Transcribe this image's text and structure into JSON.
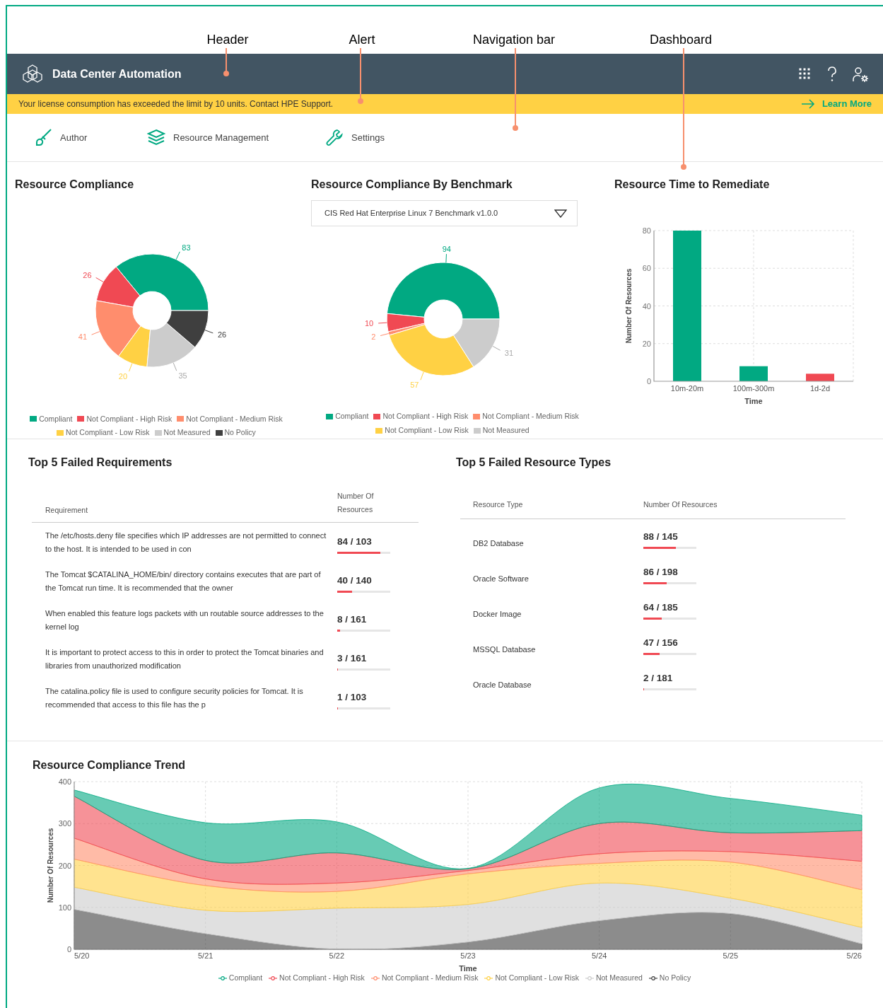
{
  "annotations": [
    {
      "label": "Header"
    },
    {
      "label": "Alert"
    },
    {
      "label": "Navigation bar"
    },
    {
      "label": "Dashboard"
    }
  ],
  "header": {
    "title": "Data Center Automation"
  },
  "alert": {
    "message": "Your license consumption has exceeded the limit by 10 units. Contact HPE Support.",
    "link": "Learn More"
  },
  "nav": {
    "items": [
      {
        "label": "Author"
      },
      {
        "label": "Resource Management"
      },
      {
        "label": "Settings"
      }
    ]
  },
  "resource_compliance": {
    "title": "Resource Compliance",
    "chart_data": {
      "type": "donut",
      "data_labels": true,
      "categories": [
        "Compliant",
        "Not Compliant - High Risk",
        "Not Compliant - Medium Risk",
        "Not Compliant - Low Risk",
        "Not Measured",
        "No Policy"
      ],
      "values": [
        83,
        26,
        41,
        20,
        35,
        26
      ]
    },
    "legend": [
      {
        "color": "#01a982"
      },
      {
        "color": "#f04953"
      },
      {
        "color": "#ff8d6d"
      },
      {
        "color": "#ffd144"
      },
      {
        "color": "#cccccc"
      },
      {
        "color": "#3f3f3f"
      }
    ]
  },
  "compliance_by_benchmark": {
    "title": "Resource Compliance By Benchmark",
    "dropdown": {
      "value": "CIS Red Hat Enterprise Linux 7 Benchmark v1.0.0"
    },
    "chart_data": {
      "type": "donut",
      "data_labels": true,
      "categories": [
        "Compliant",
        "Not Compliant - High Risk",
        "Not Compliant - Medium Risk",
        "Not Compliant - Low Risk",
        "Not Measured"
      ],
      "values": [
        94,
        10,
        2,
        57,
        31
      ]
    },
    "legend": [
      {
        "color": "#01a982"
      },
      {
        "color": "#f04953"
      },
      {
        "color": "#ff8d6d"
      },
      {
        "color": "#ffd144"
      },
      {
        "color": "#cccccc"
      }
    ]
  },
  "time_to_remediate": {
    "title": "Resource Time to Remediate",
    "chart_data": {
      "type": "bar",
      "stacked": true,
      "xlabel": "Time",
      "ylabel": "Number Of Resources",
      "categories": [
        "10m-20m",
        "100m-300m",
        "1d-2d"
      ],
      "grid": true,
      "ylim": [
        0,
        80
      ],
      "yticks": [
        0,
        20,
        40,
        60,
        80
      ],
      "series": [
        {
          "color": "#01a982",
          "values": [
            80,
            8,
            null
          ]
        },
        {
          "color": "#f04953",
          "values": [
            null,
            null,
            4
          ]
        }
      ]
    }
  },
  "failed_requirements": {
    "title": "Top 5 Failed Requirements",
    "columns": [
      "Requirement",
      "Number Of Resources"
    ],
    "rows": [
      {
        "requirement": "The /etc/hosts.deny file specifies which IP addresses are not permitted to connect to the host. It is intended to be used in con",
        "count": "84 / 103",
        "level": 0.816
      },
      {
        "requirement": "The Tomcat $CATALINA_HOME/bin/ directory contains executes that are part of the Tomcat run time. It is recommended that the owner",
        "count": "40 / 140",
        "level": 0.286
      },
      {
        "requirement": "When enabled this feature logs packets with un routable source addresses to the kernel log",
        "count": "8 / 161",
        "level": 0.05
      },
      {
        "requirement": "It is important to protect access to this in order to protect the Tomcat binaries and libraries from unauthorized modification",
        "count": "3 / 161",
        "level": 0.019
      },
      {
        "requirement": "The catalina.policy file is used to configure security policies for Tomcat. It is recommended that access to this file has the p",
        "count": "1 / 103",
        "level": 0.01
      }
    ]
  },
  "failed_resource_types": {
    "title": "Top 5 Failed Resource Types",
    "columns": [
      "Resource Type",
      "Number Of Resources"
    ],
    "rows": [
      {
        "type": "DB2 Database",
        "count": "88 / 145",
        "level": 0.607
      },
      {
        "type": "Oracle Software",
        "count": "86 / 198",
        "level": 0.434
      },
      {
        "type": "Docker Image",
        "count": "64 / 185",
        "level": 0.346
      },
      {
        "type": "MSSQL Database",
        "count": "47 / 156",
        "level": 0.301
      },
      {
        "type": "Oracle Database",
        "count": "2 / 181",
        "level": 0.011
      }
    ]
  },
  "compliance_trend": {
    "title": "Resource Compliance Trend",
    "chart_data": {
      "type": "area",
      "stacked": true,
      "xlabel": "Time",
      "ylabel": "Number Of Resources",
      "categories": [
        "5/20",
        "5/21",
        "5/22",
        "5/23",
        "5/24",
        "5/25",
        "5/26"
      ],
      "grid": true,
      "ylim": [
        0,
        400
      ],
      "yticks": [
        0,
        100,
        200,
        300,
        400
      ],
      "series": [
        {
          "name": "Compliant",
          "color": "#01a982",
          "values": [
            15,
            90,
            74,
            1,
            85,
            82,
            37
          ]
        },
        {
          "name": "Not Compliant - High Risk",
          "color": "#f04953",
          "values": [
            100,
            44,
            72,
            4,
            72,
            45,
            73
          ]
        },
        {
          "name": "Not Compliant - Medium Risk",
          "color": "#ff8d6d",
          "values": [
            50,
            16,
            20,
            8,
            23,
            25,
            68
          ]
        },
        {
          "name": "Not Compliant - Low Risk",
          "color": "#ffd144",
          "values": [
            67,
            59,
            40,
            73,
            47,
            86,
            90
          ]
        },
        {
          "name": "Not Measured",
          "color": "#cccccc",
          "values": [
            53,
            56,
            98,
            90,
            90,
            37,
            39
          ]
        },
        {
          "name": "No Policy",
          "color": "#3f3f3f",
          "values": [
            95,
            37,
            0,
            17,
            68,
            85,
            13
          ]
        }
      ]
    }
  }
}
